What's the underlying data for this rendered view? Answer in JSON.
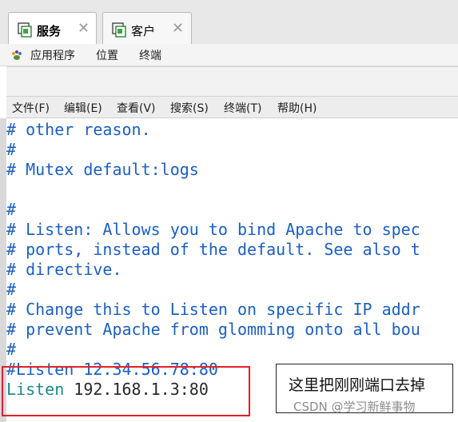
{
  "tabs": [
    {
      "label": "服务",
      "active": true
    },
    {
      "label": "客户",
      "active": false
    }
  ],
  "appbar": {
    "items": [
      "应用程序",
      "位置",
      "终端"
    ]
  },
  "terminal_menu": {
    "items": [
      "文件(F)",
      "编辑(E)",
      "查看(V)",
      "搜索(S)",
      "终端(T)",
      "帮助(H)"
    ]
  },
  "terminal": {
    "lines": [
      "# other reason.",
      "#",
      "# Mutex default:logs",
      "",
      "#",
      "# Listen: Allows you to bind Apache to spec",
      "# ports, instead of the default. See also t",
      "# directive.",
      "#",
      "# Change this to Listen on specific IP addr",
      "# prevent Apache from glomming onto all bou",
      "#",
      "#Listen 12.34.56.78:80"
    ],
    "listen_keyword": "Listen",
    "listen_value": " 192.168.1.3:80"
  },
  "annotation": {
    "note": "这里把刚刚端口去掉",
    "highlight_color": "#e0202a"
  },
  "watermark": "CSDN @学习新鲜事物"
}
